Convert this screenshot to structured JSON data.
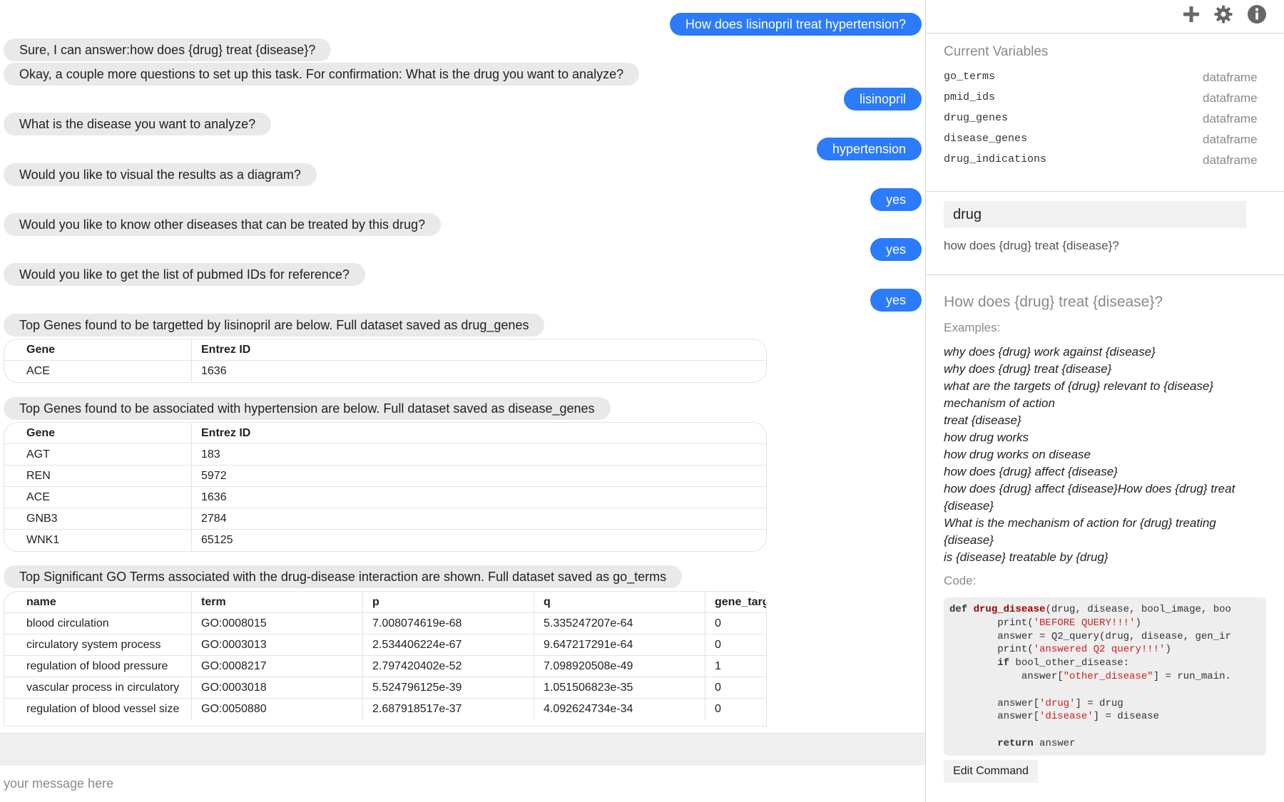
{
  "chat": {
    "messages": [
      {
        "role": "user",
        "text": "How does lisinopril treat hypertension?"
      },
      {
        "role": "bot",
        "text": "Sure, I can answer:how does {drug} treat {disease}?"
      },
      {
        "role": "bot",
        "text": "Okay, a couple more questions to set up this task. For confirmation: What is the drug you want to analyze?"
      },
      {
        "role": "user",
        "text": "lisinopril"
      },
      {
        "role": "bot",
        "text": "What is the disease you want to analyze?"
      },
      {
        "role": "user",
        "text": "hypertension"
      },
      {
        "role": "bot",
        "text": "Would you like to visual the results as a diagram?"
      },
      {
        "role": "user",
        "text": "yes"
      },
      {
        "role": "bot",
        "text": "Would you like to know other diseases that can be treated by this drug?"
      },
      {
        "role": "user",
        "text": "yes"
      },
      {
        "role": "bot",
        "text": "Would you like to get the list of pubmed IDs for reference?"
      },
      {
        "role": "user",
        "text": "yes"
      },
      {
        "role": "bot",
        "text": "Top Genes found to be targetted by lisinopril are below. Full dataset saved as drug_genes"
      },
      {
        "role": "bot",
        "text": "Top Genes found to be associated with hypertension are below. Full dataset saved as disease_genes"
      },
      {
        "role": "bot",
        "text": "Top Significant GO Terms associated with the drug-disease interaction are shown. Full dataset saved as go_terms"
      }
    ],
    "drug_genes_table": {
      "columns": [
        "Gene",
        "Entrez ID"
      ],
      "rows": [
        [
          "ACE",
          "1636"
        ]
      ]
    },
    "disease_genes_table": {
      "columns": [
        "Gene",
        "Entrez ID"
      ],
      "rows": [
        [
          "AGT",
          "183"
        ],
        [
          "REN",
          "5972"
        ],
        [
          "ACE",
          "1636"
        ],
        [
          "GNB3",
          "2784"
        ],
        [
          "WNK1",
          "65125"
        ]
      ]
    },
    "go_terms_table": {
      "columns": [
        "name",
        "term",
        "p",
        "q",
        "gene_targ"
      ],
      "rows": [
        [
          "blood circulation",
          "GO:0008015",
          "7.008074619e-68",
          "5.335247207e-64",
          "0"
        ],
        [
          "circulatory system process",
          "GO:0003013",
          "2.534406224e-67",
          "9.647217291e-64",
          "0"
        ],
        [
          "regulation of blood pressure",
          "GO:0008217",
          "2.797420402e-52",
          "7.098920508e-49",
          "1"
        ],
        [
          "vascular process in circulatory",
          "GO:0003018",
          "5.524796125e-39",
          "1.051506823e-35",
          "0"
        ],
        [
          "regulation of blood vessel size",
          "GO:0050880",
          "2.687918517e-37",
          "4.092624734e-34",
          "0"
        ]
      ]
    },
    "input_placeholder": "your message here"
  },
  "sidebar": {
    "icons": [
      "plus-icon",
      "gear-icon",
      "info-icon"
    ],
    "variables_title": "Current Variables",
    "variables": [
      {
        "name": "go_terms",
        "type": "dataframe"
      },
      {
        "name": "pmid_ids",
        "type": "dataframe"
      },
      {
        "name": "drug_genes",
        "type": "dataframe"
      },
      {
        "name": "disease_genes",
        "type": "dataframe"
      },
      {
        "name": "drug_indications",
        "type": "dataframe"
      }
    ],
    "command_name": "drug",
    "command_template": "how does {drug} treat {disease}?",
    "command_heading": "How does {drug} treat {disease}?",
    "examples_label": "Examples:",
    "examples": [
      "why does {drug} work against {disease}",
      "why does {drug} treat {disease}",
      "what are the targets of {drug} relevant to {disease}",
      "mechanism of action",
      "treat {disease}",
      "how drug works",
      "how drug works on disease",
      "how does {drug} affect {disease}",
      "how does {drug} affect {disease}How does {drug} treat {disease}",
      "What is the mechanism of action for {drug} treating {disease}",
      "is {disease} treatable by {drug}"
    ],
    "code_label": "Code:",
    "code_lines": [
      "def drug_disease(drug, disease, bool_image, boo",
      "        print('BEFORE QUERY!!!')",
      "        answer = Q2_query(drug, disease, gen_ir",
      "        print('answered Q2 query!!!')",
      "        if bool_other_disease:",
      "            answer[\"other_disease\"] = run_main.",
      "",
      "        answer['drug'] = drug",
      "        answer['disease'] = disease",
      "",
      "        return answer"
    ],
    "edit_button_label": "Edit Command"
  },
  "colors": {
    "user_bubble": "#2b7bfa",
    "bot_bubble": "#e9e9e9",
    "code_function": "#990000",
    "code_string": "#cc1f1f"
  }
}
